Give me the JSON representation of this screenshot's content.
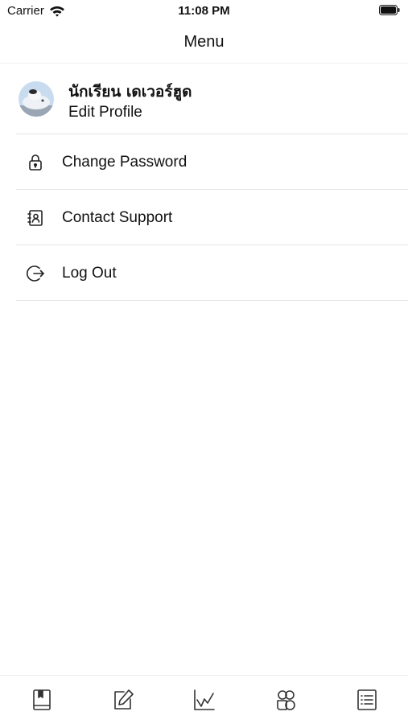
{
  "status_bar": {
    "carrier": "Carrier",
    "time": "11:08 PM"
  },
  "nav": {
    "title": "Menu"
  },
  "profile": {
    "name": "นักเรียน เดเวอร์ฮูด",
    "edit_label": "Edit Profile"
  },
  "menu": {
    "items": [
      {
        "label": "Change Password",
        "icon": "lock-icon"
      },
      {
        "label": "Contact Support",
        "icon": "contact-book-icon"
      },
      {
        "label": "Log Out",
        "icon": "logout-icon"
      }
    ]
  },
  "tab_bar": {
    "items": [
      {
        "icon": "book-icon"
      },
      {
        "icon": "edit-icon"
      },
      {
        "icon": "chart-icon"
      },
      {
        "icon": "apps-icon"
      },
      {
        "icon": "list-icon"
      }
    ]
  },
  "colors": {
    "text": "#111111",
    "separator": "#e6e6e6",
    "background": "#ffffff"
  }
}
